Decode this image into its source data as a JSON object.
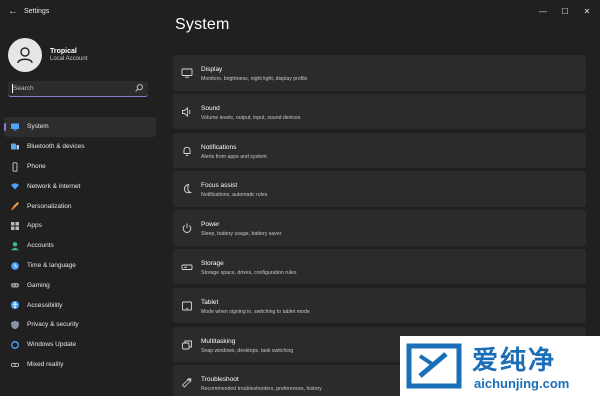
{
  "window": {
    "title": "Settings",
    "minimize": "—",
    "maximize": "☐",
    "close": "✕"
  },
  "profile": {
    "name": "Tropical",
    "account_type": "Local Account"
  },
  "search": {
    "placeholder": "Search"
  },
  "sidebar": {
    "items": [
      {
        "label": "System",
        "icon": "monitor-icon",
        "active": true
      },
      {
        "label": "Bluetooth & devices",
        "icon": "bluetooth-icon"
      },
      {
        "label": "Phone",
        "icon": "phone-icon"
      },
      {
        "label": "Network & internet",
        "icon": "wifi-icon"
      },
      {
        "label": "Personalization",
        "icon": "brush-icon"
      },
      {
        "label": "Apps",
        "icon": "apps-icon"
      },
      {
        "label": "Accounts",
        "icon": "person-icon"
      },
      {
        "label": "Time & language",
        "icon": "globe-clock-icon"
      },
      {
        "label": "Gaming",
        "icon": "gamepad-icon"
      },
      {
        "label": "Accessibility",
        "icon": "accessibility-icon"
      },
      {
        "label": "Privacy & security",
        "icon": "shield-icon"
      },
      {
        "label": "Windows Update",
        "icon": "update-icon"
      },
      {
        "label": "Mixed reality",
        "icon": "headset-icon"
      }
    ]
  },
  "main": {
    "title": "System",
    "cards": [
      {
        "title": "Display",
        "subtitle": "Monitors, brightness, night light, display profile",
        "icon": "display-icon"
      },
      {
        "title": "Sound",
        "subtitle": "Volume levels, output, input, sound devices",
        "icon": "speaker-icon"
      },
      {
        "title": "Notifications",
        "subtitle": "Alerts from apps and system",
        "icon": "bell-icon"
      },
      {
        "title": "Focus assist",
        "subtitle": "Notifications, automatic rules",
        "icon": "moon-icon"
      },
      {
        "title": "Power",
        "subtitle": "Sleep, battery usage, battery saver",
        "icon": "power-icon"
      },
      {
        "title": "Storage",
        "subtitle": "Storage space, drives, configuration rules",
        "icon": "storage-icon"
      },
      {
        "title": "Tablet",
        "subtitle": "Mode when signing in, switching to tablet mode",
        "icon": "tablet-icon"
      },
      {
        "title": "Multitasking",
        "subtitle": "Snap windows, desktops, task switching",
        "icon": "multitask-icon"
      },
      {
        "title": "Troubleshoot",
        "subtitle": "Recommended troubleshooters, preferences, history",
        "icon": "wrench-icon"
      }
    ]
  },
  "watermark": {
    "text_cn": "爱纯净",
    "url": "aichunjing.com"
  },
  "colors": {
    "background": "#202020",
    "card": "#2b2b2b",
    "accent": "#8a7bd8",
    "watermark_blue": "#1a6fb8"
  }
}
